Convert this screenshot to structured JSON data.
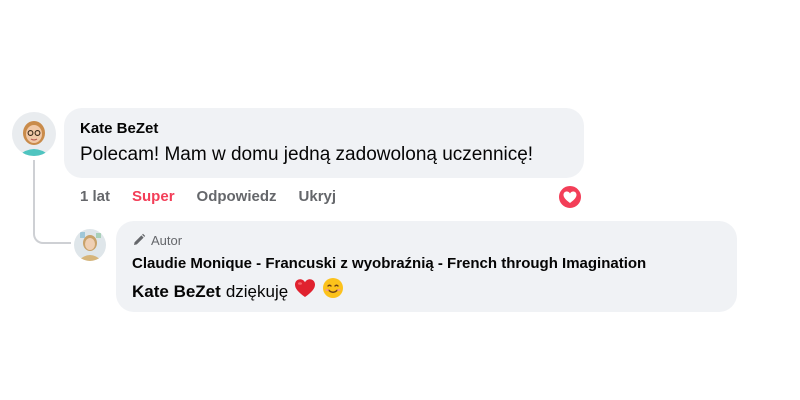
{
  "comment": {
    "author": "Kate BeZet",
    "text": "Polecam! Mam w domu jedną zadowoloną uczennicę!",
    "time": "1 lat",
    "reaction_label": "Super",
    "reply_label": "Odpowiedz",
    "hide_label": "Ukryj",
    "reaction_icon": "heart-reaction-icon"
  },
  "reply": {
    "badge_label": "Autor",
    "badge_icon": "pencil-icon",
    "author": "Claudie Monique - Francuski z wyobraźnią - French through Imagination",
    "mention": "Kate BeZet",
    "text": "dziękuję",
    "emojis": [
      "red-heart-emoji",
      "smiling-face-emoji"
    ]
  },
  "colors": {
    "bubble": "#f0f2f5",
    "super": "#f33e58",
    "secondary_text": "#65676b"
  }
}
